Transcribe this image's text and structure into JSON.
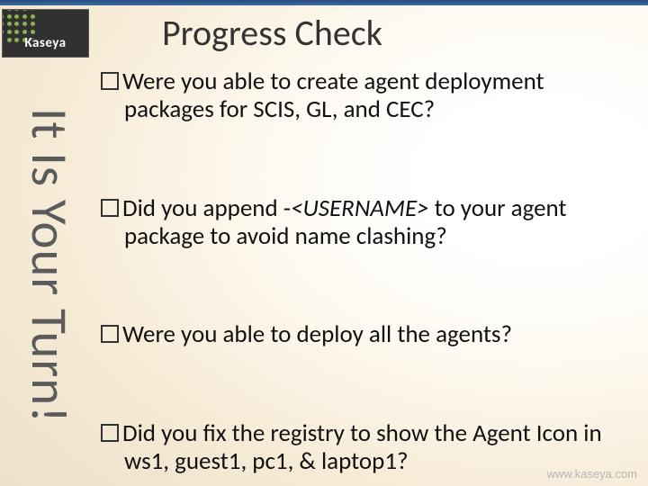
{
  "brand": {
    "logo_text": "Kaseya"
  },
  "slide": {
    "title": "Progress Check",
    "side_text": "It Is Your Turn!",
    "bullets": [
      {
        "text": "Were you able to create agent deployment packages for SCIS, GL, and CEC?"
      },
      {
        "pre": "Did you append -",
        "em": "<USERNAME>",
        "post": " to your agent package to avoid name clashing?"
      },
      {
        "text": "Were you able to deploy all the agents?"
      },
      {
        "text": "Did you fix the registry to show the Agent Icon in ws1, guest1, pc1, & laptop1?"
      }
    ]
  },
  "footer": {
    "url": "www.kaseya.com"
  }
}
